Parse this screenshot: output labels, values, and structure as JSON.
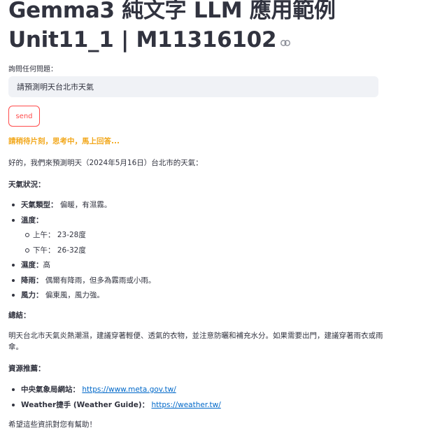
{
  "header": {
    "title_line1": "Gemma3 純文字 LLM 應用範例",
    "title_line2": "Unit11_1 | M11316102"
  },
  "form": {
    "input_label": "詢問任何問題：",
    "input_value": "請預測明天台北市天氣",
    "send_label": "send"
  },
  "status": {
    "waiting_text": "請稍待片刻，思考中，馬上回答..."
  },
  "answer": {
    "intro": "好的，我們來預測明天（2024年5月16日）台北市的天氣：",
    "weather_heading": "天氣狀況：",
    "items": [
      {
        "label": "天氣類型：",
        "text": "偏暖，有濕霧。"
      },
      {
        "label": "溫度：",
        "text": ""
      },
      {
        "label": "濕度：",
        "text": "高"
      },
      {
        "label": "降雨：",
        "text": "偶爾有降雨，但多為霧雨或小雨。"
      },
      {
        "label": "風力：",
        "text": "偏東風，風力強。"
      }
    ],
    "temperature_sub": [
      {
        "label": "上午：",
        "text": "23-28度"
      },
      {
        "label": "下午：",
        "text": "26-32度"
      }
    ],
    "summary_heading": "總結：",
    "summary_text": "明天台北市天氣炎熱潮濕，建議穿著輕便、透氣的衣物，並注意防曬和補充水分。如果需要出門，建議穿著雨衣或雨傘。",
    "resources_heading": "資源推薦：",
    "resources": [
      {
        "label": "中央氣象局網站：",
        "url": "https://www.meta.gov.tw/"
      },
      {
        "label": "Weather捷手 (Weather Guide)：",
        "url": "https://weather.tw/"
      }
    ],
    "closing": "希望這些資訊對您有幫助！"
  },
  "colors": {
    "accent": "#ff4b4b",
    "warning": "#f2a81d",
    "link": "#0068c9",
    "input_bg": "#f0f2f6",
    "text": "#31333f"
  },
  "icons": {
    "title_anchor": "link-icon"
  }
}
